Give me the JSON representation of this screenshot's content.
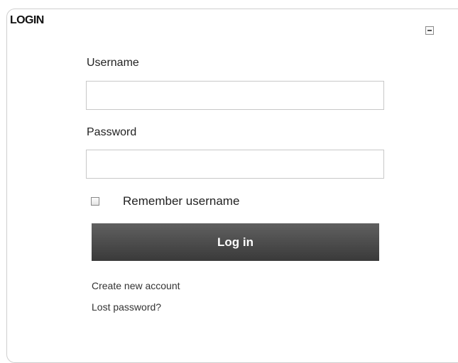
{
  "block": {
    "title": "LOGIN",
    "collapse_icon": "collapse-icon"
  },
  "form": {
    "username_label": "Username",
    "username_value": "",
    "password_label": "Password",
    "password_value": "",
    "remember_checked": false,
    "remember_label": "Remember username",
    "login_button": "Log in"
  },
  "links": {
    "create_account": "Create new account",
    "lost_password": "Lost password?"
  },
  "colors": {
    "button_bg": "#4a4a4a",
    "button_text": "#ffffff",
    "border": "#c8c8c8"
  }
}
